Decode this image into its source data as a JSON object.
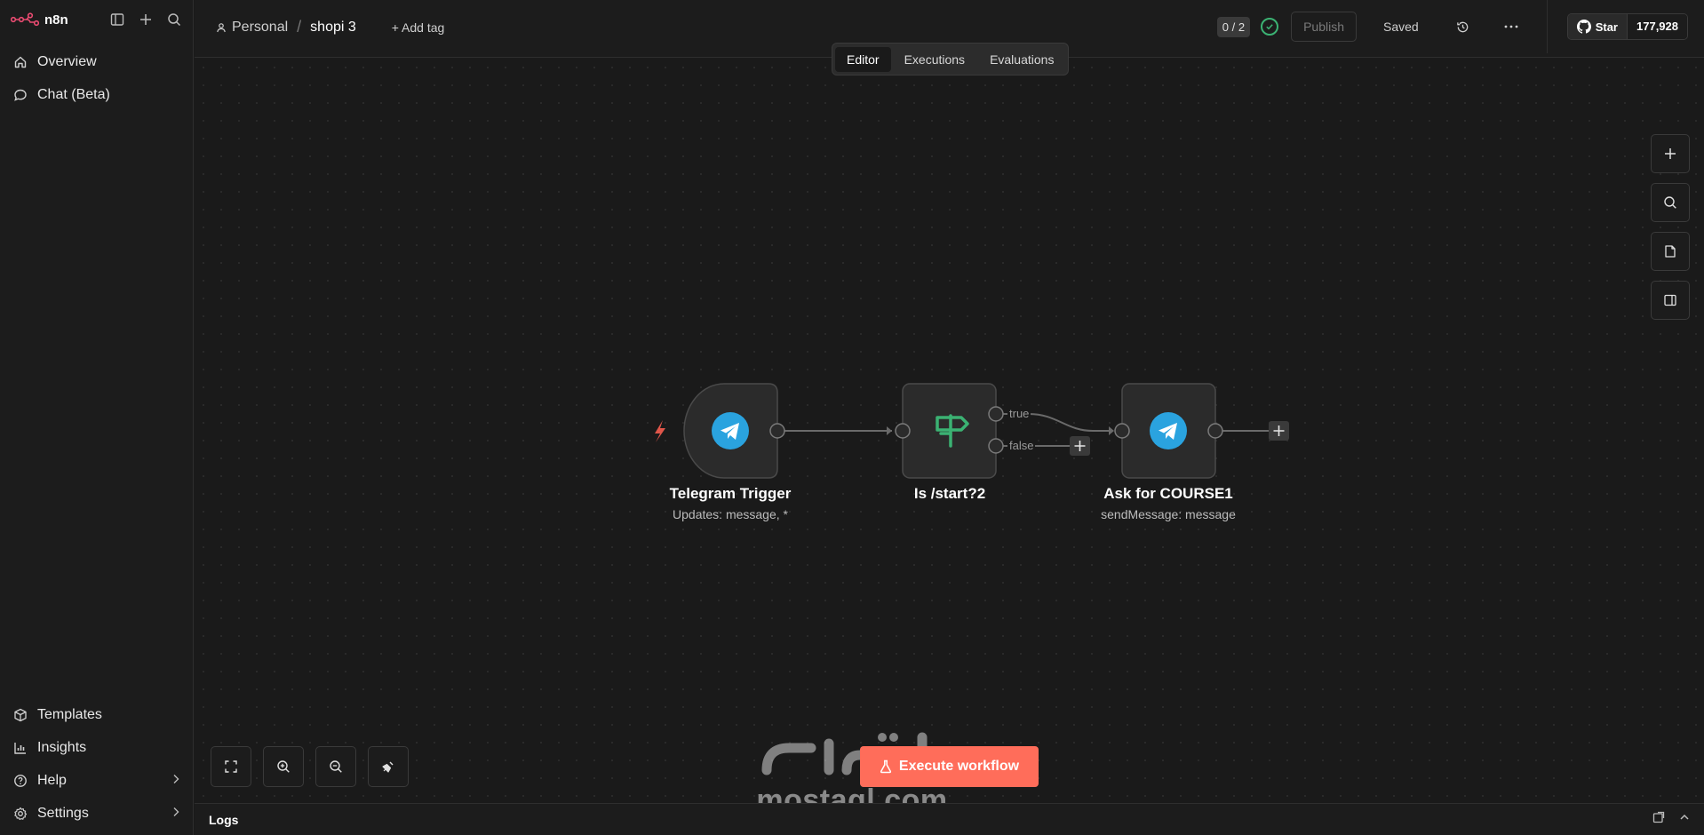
{
  "app": {
    "logo_text": "n8n"
  },
  "sidebar": {
    "top_items": [
      {
        "label": "Overview",
        "icon": "home-icon"
      },
      {
        "label": "Chat (Beta)",
        "icon": "chat-icon"
      }
    ],
    "bottom_items": [
      {
        "label": "Templates",
        "icon": "box-icon"
      },
      {
        "label": "Insights",
        "icon": "bar-chart-icon"
      },
      {
        "label": "Help",
        "icon": "help-icon"
      },
      {
        "label": "Settings",
        "icon": "gear-icon"
      }
    ]
  },
  "header": {
    "project": "Personal",
    "workflow_name": "shopi 3",
    "add_tag": "+ Add tag",
    "counter": "0 / 2",
    "publish": "Publish",
    "saved": "Saved",
    "github_star": "Star",
    "github_count": "177,928"
  },
  "tabs": [
    {
      "label": "Editor",
      "active": true
    },
    {
      "label": "Executions",
      "active": false
    },
    {
      "label": "Evaluations",
      "active": false
    }
  ],
  "workflow": {
    "nodes": [
      {
        "title": "Telegram Trigger",
        "subtitle": "Updates: message, *"
      },
      {
        "title": "Is /start?2",
        "subtitle": ""
      },
      {
        "title": "Ask for COURSE1",
        "subtitle": "sendMessage: message"
      }
    ],
    "branch_labels": {
      "true": "true",
      "false": "false"
    }
  },
  "execute_button": "Execute workflow",
  "watermark": "mostaql.com",
  "logs": {
    "label": "Logs"
  },
  "colors": {
    "accent": "#ff6d5a",
    "telegram": "#2aa3df",
    "if_node": "#3bb273",
    "canvas": "#1a1a1a"
  }
}
